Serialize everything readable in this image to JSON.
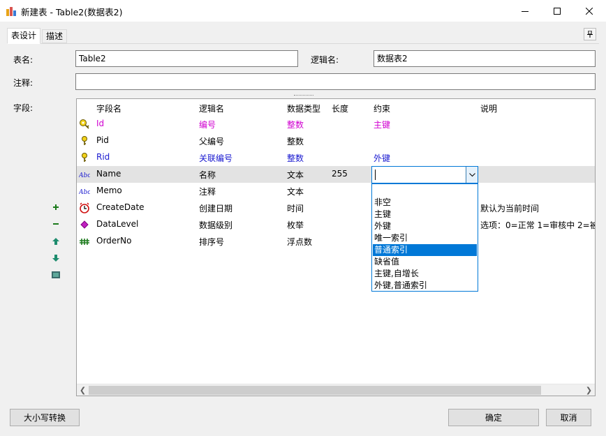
{
  "window": {
    "title": "新建表 - Table2(数据表2)",
    "icon": "table-app-icon",
    "controls": {
      "minimize": "minimize-icon",
      "maximize": "maximize-icon",
      "close": "close-icon"
    }
  },
  "tabs": [
    {
      "label": "表设计",
      "active": true
    },
    {
      "label": "描述",
      "active": false
    }
  ],
  "form": {
    "table_name_label": "表名:",
    "table_name_value": "Table2",
    "logical_name_label": "逻辑名:",
    "logical_name_value": "数据表2",
    "comment_label": "注释:",
    "comment_value": "",
    "fields_label": "字段:"
  },
  "grid": {
    "columns": [
      "字段名",
      "逻辑名",
      "数据类型",
      "长度",
      "约束",
      "说明"
    ],
    "rows": [
      {
        "icon": "primary-key-icon",
        "name": "Id",
        "logical": "编号",
        "type": "整数",
        "length": "",
        "constraint": "主键",
        "desc": "",
        "color": "#d000d0"
      },
      {
        "icon": "index-key-icon",
        "name": "Pid",
        "logical": "父编号",
        "type": "整数",
        "length": "",
        "constraint": "",
        "desc": "",
        "color": "#000000"
      },
      {
        "icon": "foreign-key-icon",
        "name": "Rid",
        "logical": "关联编号",
        "type": "整数",
        "length": "",
        "constraint": "外键",
        "desc": "",
        "color": "#1a1ad0"
      },
      {
        "icon": "text-type-icon",
        "name": "Name",
        "logical": "名称",
        "type": "文本",
        "length": "255",
        "constraint": "",
        "desc": "",
        "color": "#000000"
      },
      {
        "icon": "text-type-icon",
        "name": "Memo",
        "logical": "注释",
        "type": "文本",
        "length": "",
        "constraint": "",
        "desc": "",
        "color": "#000000"
      },
      {
        "icon": "clock-icon",
        "name": "CreateDate",
        "logical": "创建日期",
        "type": "时间",
        "length": "",
        "constraint": "",
        "desc": "默认为当前时间",
        "color": "#000000"
      },
      {
        "icon": "diamond-icon",
        "name": "DataLevel",
        "logical": "数据级别",
        "type": "枚举",
        "length": "",
        "constraint": "",
        "desc": "选项：0=正常 1=审核中 2=被",
        "color": "#000000"
      },
      {
        "icon": "number-type-icon",
        "name": "OrderNo",
        "logical": "排序号",
        "type": "浮点数",
        "length": "",
        "constraint": "",
        "desc": "",
        "color": "#000000"
      }
    ]
  },
  "constraint_editor": {
    "value": "",
    "options": [
      "",
      "非空",
      "主键",
      "外键",
      "唯一索引",
      "普通索引",
      "缺省值",
      "主键,自增长",
      "外键,普通索引"
    ],
    "highlighted": "普通索引"
  },
  "side_toolbar": [
    "add-field-icon",
    "remove-field-icon",
    "move-up-icon",
    "move-down-icon",
    "field-properties-icon"
  ],
  "buttons": {
    "case_convert": "大小写转换",
    "ok": "确定",
    "cancel": "取消"
  },
  "colors": {
    "accent": "#0078d7",
    "selected_row": "#e3e3e3"
  }
}
